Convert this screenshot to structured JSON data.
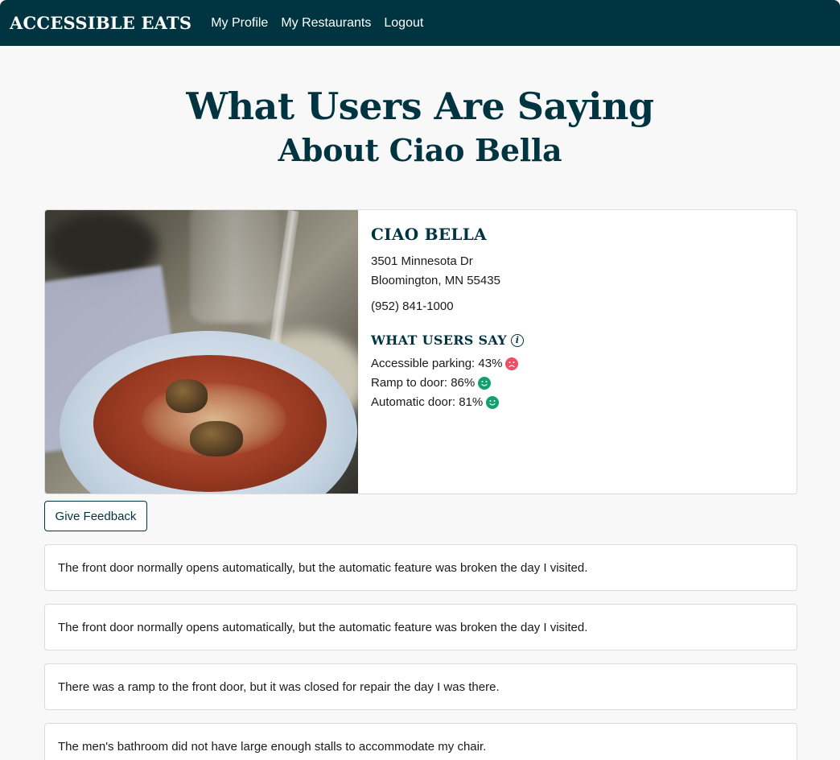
{
  "navbar": {
    "brand": "ACCESSIBLE EATS",
    "links": [
      "My Profile",
      "My Restaurants",
      "Logout"
    ]
  },
  "page": {
    "title_line1": "What Users Are Saying",
    "title_line2": "About Ciao Bella"
  },
  "restaurant": {
    "name": "CIAO BELLA",
    "address_line1": "3501 Minnesota Dr",
    "address_line2": "Bloomington, MN 55435",
    "phone": "(952) 841-1000",
    "what_users_say_title": "WHAT USERS SAY",
    "stats": [
      {
        "label": "Accessible parking: 43%",
        "sentiment": "sad",
        "color": "#ee4d64"
      },
      {
        "label": "Ramp to door: 86%",
        "sentiment": "happy",
        "color": "#14a06e"
      },
      {
        "label": "Automatic door: 81%",
        "sentiment": "happy",
        "color": "#14a06e"
      }
    ]
  },
  "feedback_button": "Give Feedback",
  "comments": [
    "The front door normally opens automatically, but the automatic feature was broken the day I visited.",
    "The front door normally opens automatically, but the automatic feature was broken the day I visited.",
    "There was a ramp to the front door, but it was closed for repair the day I was there.",
    "The men's bathroom did not have large enough stalls to accommodate my chair."
  ],
  "colors": {
    "primary": "#003440",
    "background": "#f8f8f8",
    "sad": "#ee4d64",
    "happy": "#14a06e"
  }
}
